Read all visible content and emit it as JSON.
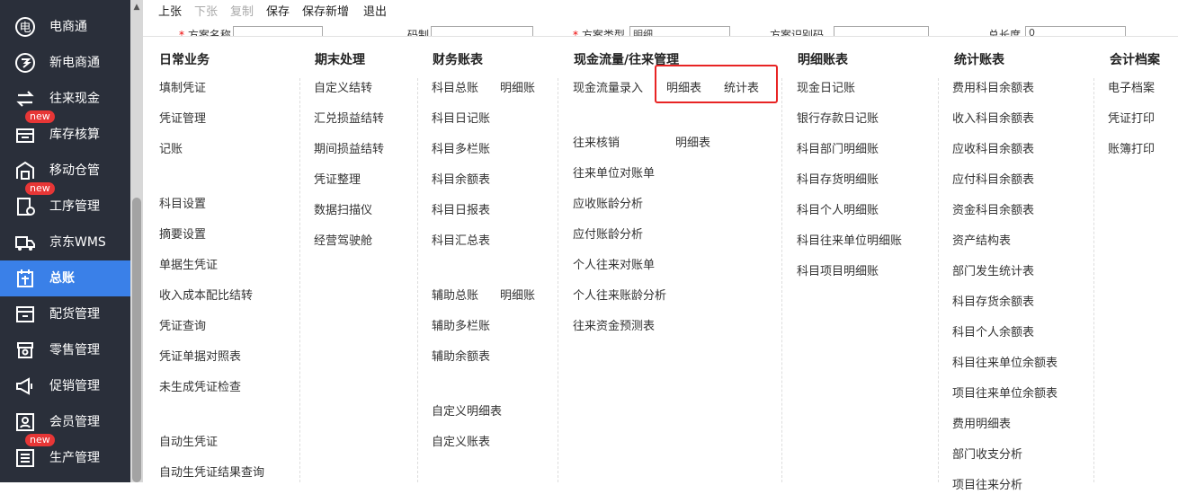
{
  "sidebar": {
    "new_badge": "new",
    "items": [
      {
        "label": "电商通",
        "icon": "ecommerce-icon"
      },
      {
        "label": "新电商通",
        "icon": "new-ecommerce-icon"
      },
      {
        "label": "往来现金",
        "icon": "exchange-icon"
      },
      {
        "label": "库存核算",
        "icon": "inventory-icon"
      },
      {
        "label": "移动仓管",
        "icon": "warehouse-icon"
      },
      {
        "label": "工序管理",
        "icon": "process-icon"
      },
      {
        "label": "京东WMS",
        "icon": "truck-icon"
      },
      {
        "label": "总账",
        "icon": "ledger-icon"
      },
      {
        "label": "配货管理",
        "icon": "delivery-icon"
      },
      {
        "label": "零售管理",
        "icon": "retail-icon"
      },
      {
        "label": "促销管理",
        "icon": "megaphone-icon"
      },
      {
        "label": "会员管理",
        "icon": "member-icon"
      },
      {
        "label": "生产管理",
        "icon": "production-icon"
      }
    ],
    "active_color": "#3a80e8"
  },
  "toolbar": {
    "prev": "上张",
    "next": "下张",
    "copy": "复制",
    "save": "保存",
    "save_new": "保存新增",
    "exit": "退出"
  },
  "form_row": {
    "star": "*",
    "f1_label": "方案名称",
    "f2_label": "码制",
    "f3_label": "方案类型",
    "f3_value": "明细",
    "f4_label": "方案识别码",
    "f5_label": "总长度",
    "f5_value": "0"
  },
  "menu": {
    "columns": [
      {
        "title": "日常业务"
      },
      {
        "title": "期末处理"
      },
      {
        "title": "财务账表"
      },
      {
        "title": "现金流量/往来管理"
      },
      {
        "title": "明细账表"
      },
      {
        "title": "统计账表"
      },
      {
        "title": "会计档案"
      }
    ],
    "daily": [
      "填制凭证",
      "凭证管理",
      "记账",
      "科目设置",
      "摘要设置",
      "单据生凭证",
      "收入成本配比结转",
      "凭证查询",
      "凭证单据对照表",
      "未生成凭证检查",
      "自动生凭证",
      "自动生凭证结果查询"
    ],
    "period_end": [
      "自定义结转",
      "汇兑损益结转",
      "期间损益结转",
      "凭证整理",
      "数据扫描仪",
      "经营驾驶舱"
    ],
    "finance": [
      "科目总账",
      "明细账",
      "科目日记账",
      "科目多栏账",
      "科目余额表",
      "科目日报表",
      "科目汇总表",
      "辅助总账",
      "明细账",
      "辅助多栏账",
      "辅助余额表",
      "自定义明细表",
      "自定义账表"
    ],
    "cashflow": [
      "现金流量录入",
      "明细表",
      "统计表",
      "往来核销",
      "明细表",
      "往来单位对账单",
      "应收账龄分析",
      "应付账龄分析",
      "个人往来对账单",
      "个人往来账龄分析",
      "往来资金预测表"
    ],
    "detail": [
      "现金日记账",
      "银行存款日记账",
      "科目部门明细账",
      "科目存货明细账",
      "科目个人明细账",
      "科目往来单位明细账",
      "科目项目明细账"
    ],
    "stats": [
      "费用科目余额表",
      "收入科目余额表",
      "应收科目余额表",
      "应付科目余额表",
      "资金科目余额表",
      "资产结构表",
      "部门发生统计表",
      "科目存货余额表",
      "科目个人余额表",
      "科目往来单位余额表",
      "项目往来单位余额表",
      "费用明细表",
      "部门收支分析",
      "项目往来分析"
    ],
    "archive": [
      "电子档案",
      "凭证打印",
      "账簿打印"
    ],
    "highlight_color": "#e82424"
  }
}
